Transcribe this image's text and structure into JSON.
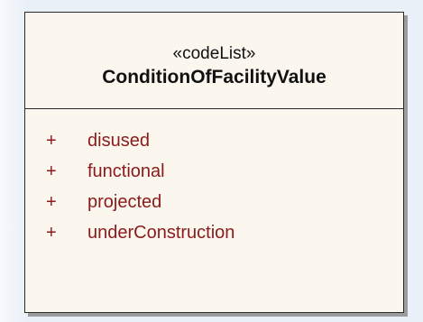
{
  "class": {
    "stereotype": "«codeList»",
    "name": "ConditionOfFacilityValue",
    "attributes": [
      {
        "visibility": "+",
        "name": "disused"
      },
      {
        "visibility": "+",
        "name": "functional"
      },
      {
        "visibility": "+",
        "name": "projected"
      },
      {
        "visibility": "+",
        "name": "underConstruction"
      }
    ]
  },
  "colors": {
    "box_fill": "#fbf6ee",
    "attribute_text": "#8b1a1a",
    "border": "#2a2a2a"
  }
}
